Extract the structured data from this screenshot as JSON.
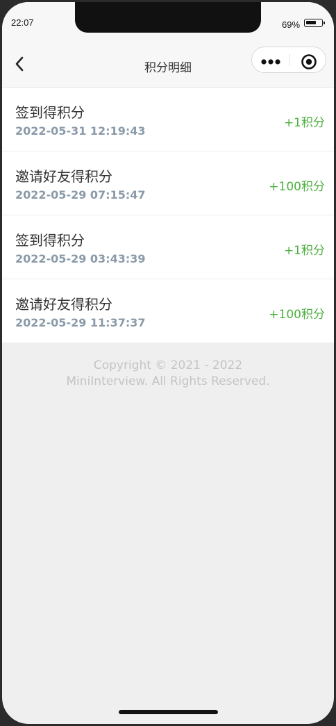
{
  "status_bar": {
    "time": "22:07",
    "battery": "69%",
    "battery_level": 0.69
  },
  "nav": {
    "title": "积分明细",
    "back_icon": "chevron-left-icon",
    "more_icon": "more-dots-icon",
    "close_icon": "target-close-icon"
  },
  "records": [
    {
      "title": "签到得积分",
      "time": "2022-05-31 12:19:43",
      "points": "+1积分"
    },
    {
      "title": "邀请好友得积分",
      "time": "2022-05-29 07:15:47",
      "points": "+100积分"
    },
    {
      "title": "签到得积分",
      "time": "2022-05-29 03:43:39",
      "points": "+1积分"
    },
    {
      "title": "邀请好友得积分",
      "time": "2022-05-29 11:37:37",
      "points": "+100积分"
    }
  ],
  "footer": {
    "line1": "Copyright © 2021 - 2022",
    "line2": "MiniInterview. All Rights Reserved."
  },
  "colors": {
    "points": "#4caf3f",
    "time": "#8a9aa8",
    "background": "#efefef"
  }
}
